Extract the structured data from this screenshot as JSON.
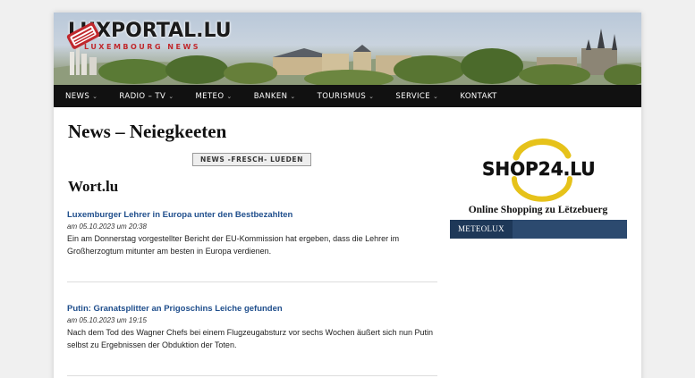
{
  "site": {
    "logo_title": "LUXPORTAL.LU",
    "logo_subtitle": "LUXEMBOURG NEWS"
  },
  "nav": {
    "items": [
      {
        "label": "NEWS",
        "has_dropdown": true
      },
      {
        "label": "RADIO – TV",
        "has_dropdown": true
      },
      {
        "label": "METEO",
        "has_dropdown": true
      },
      {
        "label": "BANKEN",
        "has_dropdown": true
      },
      {
        "label": "TOURISMUS",
        "has_dropdown": true
      },
      {
        "label": "SERVICE",
        "has_dropdown": true
      },
      {
        "label": "KONTAKT",
        "has_dropdown": false
      }
    ],
    "chevron": "⌄"
  },
  "main": {
    "page_title": "News – Neiegkeeten",
    "badge": "NEWS -FRESCH- LUEDEN",
    "section_title": "Wort.lu",
    "articles": [
      {
        "title": "Luxemburger Lehrer in Europa unter den Bestbezahlten",
        "date": "am 05.10.2023 um 20:38",
        "text": "Ein am Donnerstag vorgestellter Bericht der EU-Kommission hat ergeben, dass die Lehrer im Großherzogtum mitunter am besten in Europa verdienen."
      },
      {
        "title": "Putin: Granatsplitter an Prigoschins Leiche gefunden",
        "date": "am 05.10.2023 um 19:15",
        "text": "Nach dem Tod des Wagner Chefs bei einem Flugzeugabsturz vor sechs Wochen äußert sich nun Putin selbst zu Ergebnissen der Obduktion der Toten."
      }
    ]
  },
  "sidebar": {
    "shop_logo_text": "SHOP24.LU",
    "shop_caption": "Online Shopping zu Lëtzebuerg",
    "meteo_tab": "METEOLUX"
  },
  "colors": {
    "nav_bg": "#111111",
    "link": "#1f4e8c",
    "logo_red": "#c0282d",
    "meteo_bar": "#2c4a6f",
    "shop_yellow": "#e6c21a"
  }
}
